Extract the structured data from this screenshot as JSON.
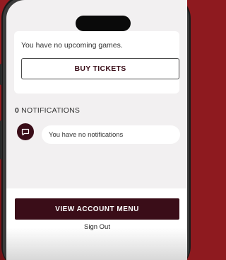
{
  "tickets": {
    "no_games_text": "You have no upcoming games.",
    "buy_button_label": "BUY TICKETS"
  },
  "notifications": {
    "count": "0",
    "heading": "NOTIFICATIONS",
    "empty_message": "You have no notifications",
    "icon": "chat-bubble-icon"
  },
  "footer": {
    "account_button_label": "VIEW ACCOUNT MENU",
    "sign_out_label": "Sign Out"
  },
  "colors": {
    "brand_maroon": "#3a0d18",
    "background_red": "#8e1a1f",
    "screen_bg": "#f2f0f1"
  }
}
